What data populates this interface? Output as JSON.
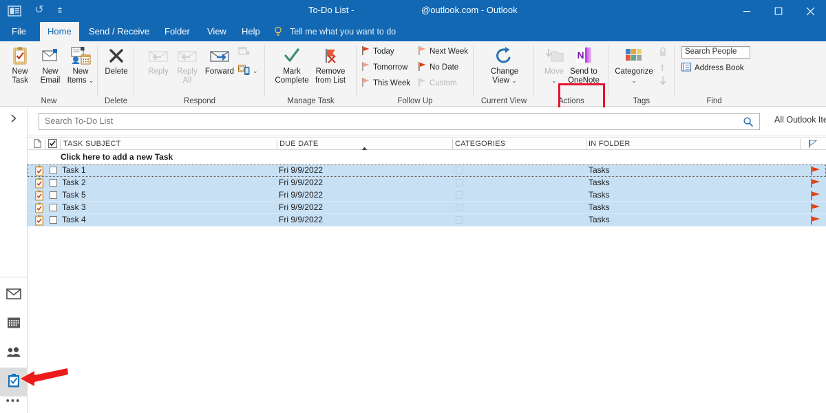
{
  "window": {
    "title_left": "To-Do List -",
    "title_right": "@outlook.com  -  Outlook",
    "quick_access": {
      "app_icon": "outlook-tasks-icon",
      "undo": "undo-icon",
      "customize": "customize-quick-access-toolbar-icon"
    },
    "controls": {
      "ribbon_display": "ribbon-display-options",
      "minimize": "minimize",
      "maximize": "maximize",
      "close": "close"
    }
  },
  "tabs": [
    {
      "label": "File",
      "active": false
    },
    {
      "label": "Home",
      "active": true
    },
    {
      "label": "Send / Receive",
      "active": false
    },
    {
      "label": "Folder",
      "active": false
    },
    {
      "label": "View",
      "active": false
    },
    {
      "label": "Help",
      "active": false
    }
  ],
  "tell_me": {
    "label": "Tell me what you want to do",
    "icon": "lightbulb-icon"
  },
  "ribbon": {
    "groups": [
      {
        "name": "New",
        "label": "New",
        "buttons": [
          {
            "label_line1": "New",
            "label_line2": "Task",
            "icon": "new-task-icon",
            "disabled": false
          },
          {
            "label_line1": "New",
            "label_line2": "Email",
            "icon": "new-email-icon",
            "disabled": false
          },
          {
            "label_line1": "New",
            "label_line2": "Items",
            "icon": "new-items-icon",
            "disabled": false,
            "caret": true
          }
        ]
      },
      {
        "name": "Delete",
        "label": "Delete",
        "buttons": [
          {
            "label_line1": "Delete",
            "label_line2": "",
            "icon": "delete-icon",
            "disabled": false
          }
        ]
      },
      {
        "name": "Respond",
        "label": "Respond",
        "buttons": [
          {
            "label_line1": "Reply",
            "label_line2": "",
            "icon": "reply-icon",
            "disabled": true
          },
          {
            "label_line1": "Reply",
            "label_line2": "All",
            "icon": "reply-all-icon",
            "disabled": true
          },
          {
            "label_line1": "Forward",
            "label_line2": "",
            "icon": "forward-icon",
            "disabled": false
          }
        ],
        "small_icons": [
          {
            "name": "meeting-icon",
            "disabled": true
          },
          {
            "name": "reply-with-im-icon",
            "disabled": false,
            "caret": true
          }
        ]
      },
      {
        "name": "Manage Task",
        "label": "Manage Task",
        "buttons": [
          {
            "label_line1": "Mark",
            "label_line2": "Complete",
            "icon": "mark-complete-icon",
            "disabled": false
          },
          {
            "label_line1": "Remove",
            "label_line2": "from List",
            "icon": "remove-from-list-icon",
            "disabled": false
          }
        ]
      },
      {
        "name": "Follow Up",
        "label": "Follow Up",
        "items": [
          {
            "label": "Today",
            "icon": "flag-icon",
            "flag_color": "#e04010",
            "disabled": false
          },
          {
            "label": "Tomorrow",
            "icon": "flag-icon",
            "flag_color": "#efa089",
            "disabled": false
          },
          {
            "label": "This Week",
            "icon": "flag-icon",
            "flag_color": "#efa089",
            "disabled": false
          },
          {
            "label": "Next Week",
            "icon": "flag-icon",
            "flag_color": "#efa089",
            "disabled": false
          },
          {
            "label": "No Date",
            "icon": "flag-icon",
            "flag_color": "#e04010",
            "disabled": false
          },
          {
            "label": "Custom",
            "icon": "flag-icon",
            "flag_color": "#c6c6c6",
            "disabled": true
          }
        ]
      },
      {
        "name": "Current View",
        "label": "Current View",
        "buttons": [
          {
            "label_line1": "Change",
            "label_line2": "View",
            "icon": "change-view-icon",
            "disabled": false,
            "caret": true
          }
        ]
      },
      {
        "name": "Actions",
        "label": "Actions",
        "buttons": [
          {
            "label_line1": "Move",
            "label_line2": "",
            "icon": "move-icon",
            "disabled": true,
            "caret": true
          },
          {
            "label_line1": "Send to",
            "label_line2": "OneNote",
            "icon": "onenote-icon",
            "disabled": false,
            "highlighted": true
          }
        ]
      },
      {
        "name": "Tags",
        "label": "Tags",
        "buttons": [
          {
            "label_line1": "Categorize",
            "label_line2": "",
            "icon": "categorize-icon",
            "disabled": false,
            "caret": true
          }
        ],
        "small_icons": [
          {
            "name": "private-lock-icon",
            "disabled": true
          },
          {
            "name": "high-importance-icon",
            "disabled": true
          },
          {
            "name": "low-importance-icon",
            "disabled": true
          }
        ]
      },
      {
        "name": "Find",
        "label": "Find",
        "items": [
          {
            "label": "Search People",
            "icon": "search-people-input",
            "is_input": true
          },
          {
            "label": "Address Book",
            "icon": "address-book-icon",
            "is_input": false
          }
        ]
      }
    ],
    "highlight_color": "#e8112d"
  },
  "search": {
    "placeholder": "Search To-Do List",
    "value": "",
    "icon": "search-icon",
    "scope_label": "All Outlook Items"
  },
  "list": {
    "columns": [
      {
        "key": "attachment",
        "label": ""
      },
      {
        "key": "complete",
        "label": ""
      },
      {
        "key": "subject",
        "label": "TASK SUBJECT"
      },
      {
        "key": "due",
        "label": "DUE DATE",
        "sorted": "asc"
      },
      {
        "key": "categories",
        "label": "CATEGORIES"
      },
      {
        "key": "folder",
        "label": "IN FOLDER"
      },
      {
        "key": "flag",
        "label": ""
      }
    ],
    "add_new_row": "Click here to add a new Task",
    "filter_icon": "filter-flag-icon",
    "selection_color": "#c8e0f4",
    "rows": [
      {
        "subject": "Task 1",
        "due": "Fri 9/9/2022",
        "categories": "",
        "folder": "Tasks",
        "selected": true,
        "focused": true,
        "flag": "flag-icon",
        "icon": "task-icon"
      },
      {
        "subject": "Task 2",
        "due": "Fri 9/9/2022",
        "categories": "",
        "folder": "Tasks",
        "selected": true,
        "focused": false,
        "flag": "flag-icon",
        "icon": "task-icon"
      },
      {
        "subject": "Task 5",
        "due": "Fri 9/9/2022",
        "categories": "",
        "folder": "Tasks",
        "selected": true,
        "focused": false,
        "flag": "flag-icon",
        "icon": "task-icon"
      },
      {
        "subject": "Task 3",
        "due": "Fri 9/9/2022",
        "categories": "",
        "folder": "Tasks",
        "selected": true,
        "focused": false,
        "flag": "flag-icon",
        "icon": "task-icon"
      },
      {
        "subject": "Task 4",
        "due": "Fri 9/9/2022",
        "categories": "",
        "folder": "Tasks",
        "selected": true,
        "focused": false,
        "flag": "flag-icon",
        "icon": "task-icon"
      }
    ]
  },
  "nav": {
    "expand_icon": "chevron-right-icon",
    "items": [
      {
        "name": "mail",
        "icon": "mail-icon",
        "active": false
      },
      {
        "name": "calendar",
        "icon": "calendar-icon",
        "active": false
      },
      {
        "name": "people",
        "icon": "people-icon",
        "active": false
      },
      {
        "name": "tasks",
        "icon": "tasks-icon",
        "active": true
      }
    ],
    "more_label": "•••"
  },
  "annotation": {
    "type": "arrow",
    "color": "#ee1b1b",
    "points_to": "sidebar-item-tasks"
  }
}
